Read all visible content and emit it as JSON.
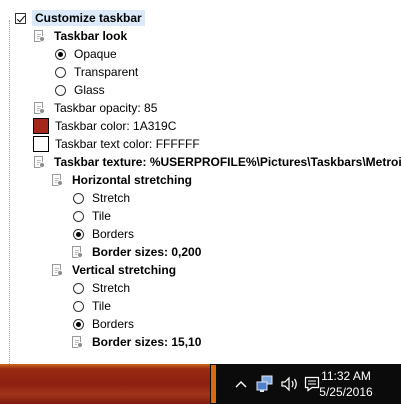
{
  "tree": {
    "root_label": "Customize taskbar",
    "look_label": "Taskbar look",
    "look_options": [
      "Opaque",
      "Transparent",
      "Glass"
    ],
    "opacity_label": "Taskbar opacity: 85",
    "color_label": "Taskbar color: 1A319C",
    "text_color_label": "Taskbar text color: FFFFFF",
    "texture_label": "Taskbar texture: %USERPROFILE%\\Pictures\\Taskbars\\Metroid",
    "horizontal": {
      "label": "Horizontal stretching",
      "options": [
        "Stretch",
        "Tile",
        "Borders"
      ],
      "border_sizes": "Border sizes: 0,200"
    },
    "vertical": {
      "label": "Vertical stretching",
      "options": [
        "Stretch",
        "Tile",
        "Borders"
      ],
      "border_sizes": "Border sizes: 15,10"
    }
  },
  "colors": {
    "taskbar_swatch": "#a3281b",
    "text_swatch": "#ffffff",
    "selection": "#dbe9f8"
  },
  "taskbar": {
    "time": "11:32 AM",
    "date": "5/25/2016",
    "tray_icons": [
      "chevron-up-icon",
      "network-icon",
      "volume-icon",
      "action-center-icon"
    ]
  }
}
